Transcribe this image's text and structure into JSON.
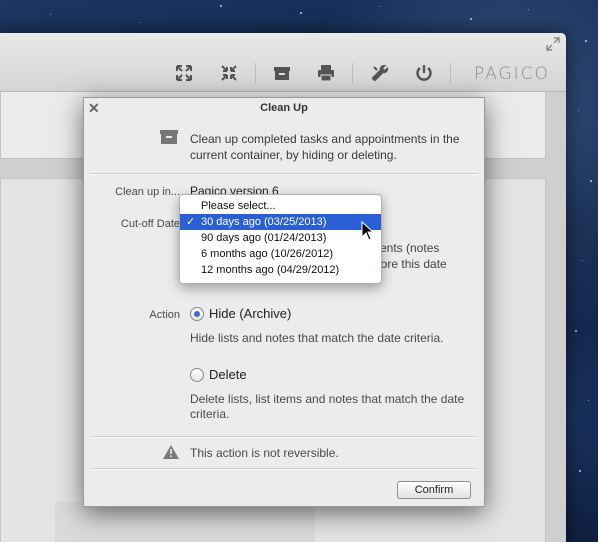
{
  "app": {
    "logo": "PAGICO",
    "toolbar_icons": [
      "expand-icon",
      "collapse-icon",
      "archive-icon",
      "print-icon",
      "tools-icon",
      "power-icon"
    ]
  },
  "dialog": {
    "title": "Clean Up",
    "description": "Clean up completed tasks and appointments in the current container, by hiding or deleting.",
    "clean_up_in_label": "Clean up in...",
    "clean_up_in_value": "Pagico version 6",
    "cutoff_label": "Cut-off Date",
    "hidden_text_line1": "ments (notes",
    "hidden_text_line2": "before this date",
    "action_label": "Action",
    "hide_label": "Hide (Archive)",
    "hide_desc": "Hide lists and notes that match the date criteria.",
    "delete_label": "Delete",
    "delete_desc": "Delete lists, list items and notes that match the date criteria.",
    "warning": "This action is not reversible.",
    "confirm": "Confirm",
    "selected_action": "Hide (Archive)"
  },
  "dropdown": {
    "options": [
      "Please select...",
      "30 days ago (03/25/2013)",
      "90 days ago (01/24/2013)",
      "6 months ago (10/26/2012)",
      "12 months ago (04/29/2012)"
    ],
    "selected": "30 days ago (03/25/2013)",
    "check": "✓"
  },
  "colors": {
    "selection": "#2a5fd6",
    "radio_dot": "#3a6fc8"
  }
}
